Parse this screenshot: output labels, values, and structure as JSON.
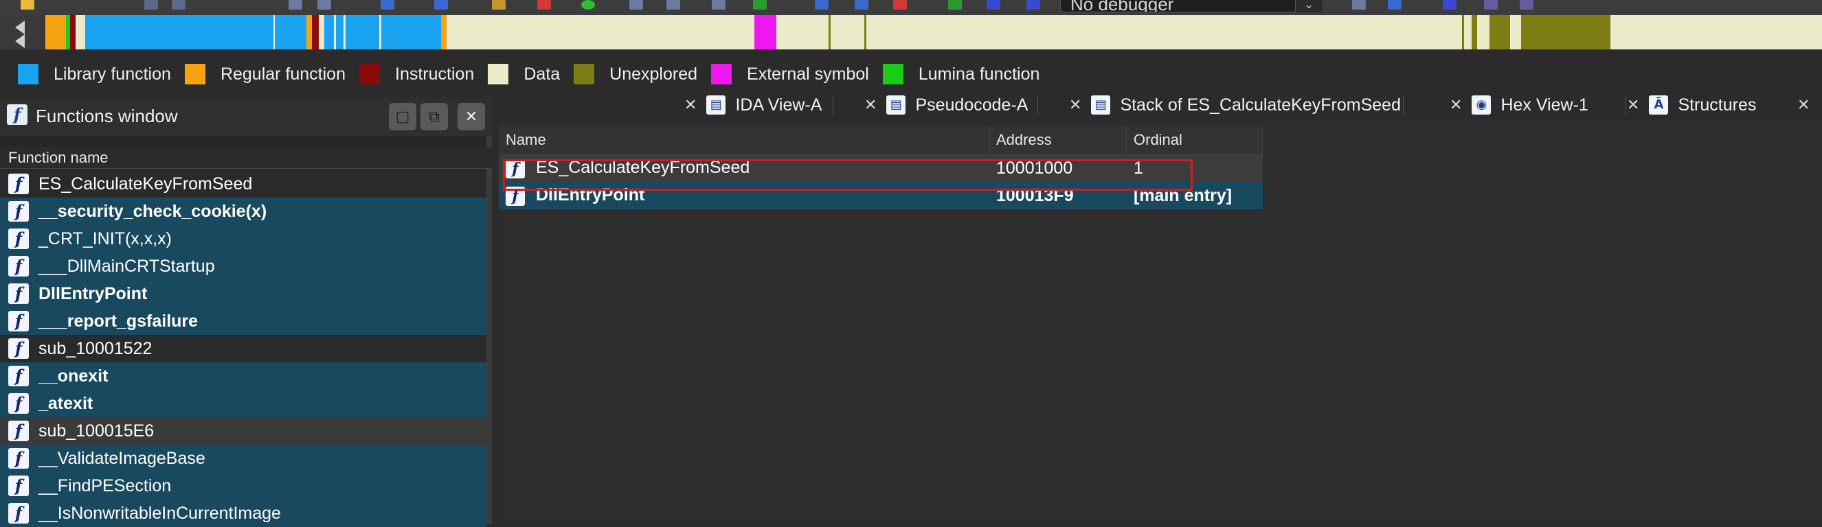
{
  "toolbar": {
    "debugger_select": "No debugger"
  },
  "legend": [
    {
      "label": "Library function",
      "color": "#1aa3f0"
    },
    {
      "label": "Regular function",
      "color": "#f5a30f"
    },
    {
      "label": "Instruction",
      "color": "#8b0a0a"
    },
    {
      "label": "Data",
      "color": "#ebebca"
    },
    {
      "label": "Unexplored",
      "color": "#7d7d14"
    },
    {
      "label": "External symbol",
      "color": "#ee18ee"
    },
    {
      "label": "Lumina function",
      "color": "#18cc18"
    }
  ],
  "functions_window": {
    "title": "Functions window",
    "column_header": "Function name",
    "rows": [
      {
        "name": "ES_CalculateKeyFromSeed",
        "kind": "regular",
        "bold": false
      },
      {
        "name": "__security_check_cookie(x)",
        "kind": "library",
        "bold": true
      },
      {
        "name": "_CRT_INIT(x,x,x)",
        "kind": "library",
        "bold": false
      },
      {
        "name": "___DllMainCRTStartup",
        "kind": "library",
        "bold": false
      },
      {
        "name": "DllEntryPoint",
        "kind": "library",
        "bold": true
      },
      {
        "name": "___report_gsfailure",
        "kind": "library",
        "bold": true
      },
      {
        "name": "sub_10001522",
        "kind": "regular",
        "bold": false
      },
      {
        "name": "__onexit",
        "kind": "library",
        "bold": true
      },
      {
        "name": "_atexit",
        "kind": "library",
        "bold": true
      },
      {
        "name": "sub_100015E6",
        "kind": "selected",
        "bold": false
      },
      {
        "name": "__ValidateImageBase",
        "kind": "library",
        "bold": false
      },
      {
        "name": "__FindPESection",
        "kind": "library",
        "bold": false
      },
      {
        "name": "__IsNonwritableInCurrentImage",
        "kind": "library",
        "bold": false
      }
    ]
  },
  "tabs": [
    {
      "label": "IDA View-A",
      "icon": "ida-view-icon"
    },
    {
      "label": "Pseudocode-A",
      "icon": "pseudocode-icon"
    },
    {
      "label": "Stack of ES_CalculateKeyFromSeed",
      "icon": "stack-icon"
    },
    {
      "label": "Hex View-1",
      "icon": "hex-view-icon"
    },
    {
      "label": "Structures",
      "icon": "structures-icon"
    }
  ],
  "exports": {
    "columns": [
      "Name",
      "Address",
      "Ordinal"
    ],
    "rows": [
      {
        "name": "ES_CalculateKeyFromSeed",
        "address": "10001000",
        "ordinal": "1"
      },
      {
        "name": "DllEntryPoint",
        "address": "100013F9",
        "ordinal": "[main entry]"
      }
    ]
  }
}
